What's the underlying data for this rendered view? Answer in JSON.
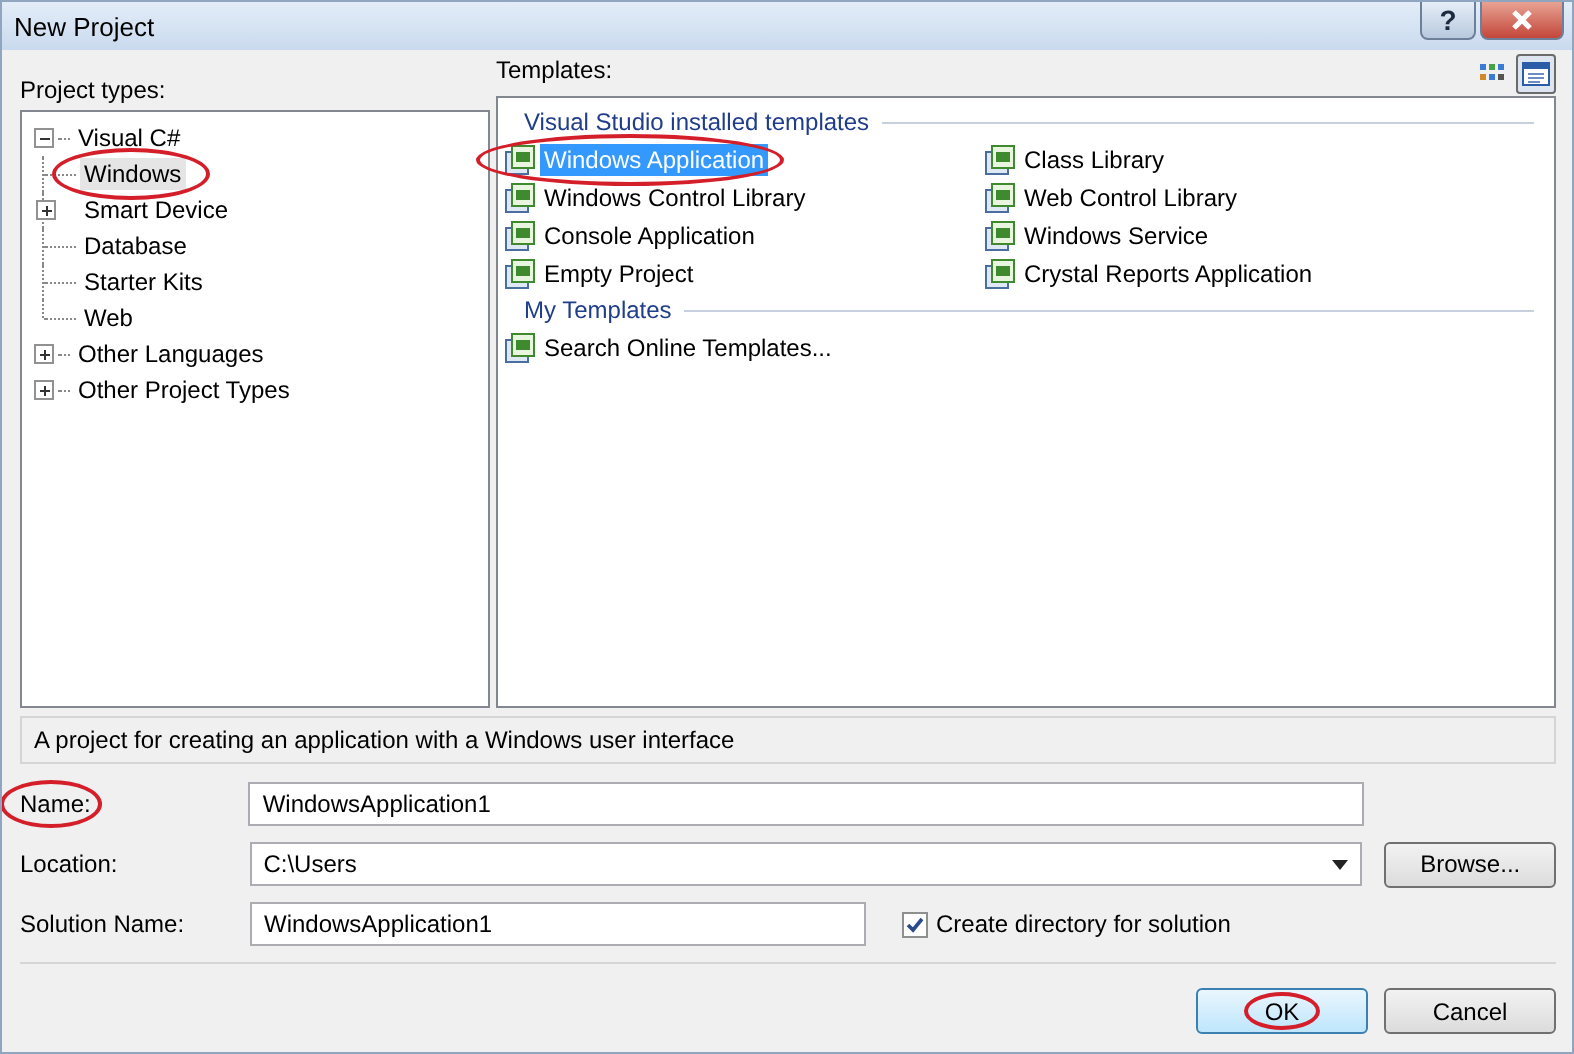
{
  "window": {
    "title": "New Project",
    "help": "?"
  },
  "project_types": {
    "label": "Project types:",
    "tree": [
      {
        "label": "Visual C#",
        "expanded": true,
        "selected": false,
        "children": [
          {
            "label": "Windows",
            "selected": true,
            "circled": true
          },
          {
            "label": "Smart Device",
            "expanded": false,
            "selected": false
          },
          {
            "label": "Database",
            "selected": false
          },
          {
            "label": "Starter Kits",
            "selected": false
          },
          {
            "label": "Web",
            "selected": false
          }
        ]
      },
      {
        "label": "Other Languages",
        "expanded": false,
        "selected": false
      },
      {
        "label": "Other Project Types",
        "expanded": false,
        "selected": false
      }
    ]
  },
  "templates": {
    "label": "Templates:",
    "view_buttons": [
      {
        "selected": false
      },
      {
        "selected": true
      }
    ],
    "groups": [
      {
        "title": "Visual Studio installed templates",
        "items": [
          {
            "label": "Windows Application",
            "selected": true,
            "circled": true
          },
          {
            "label": "Windows Control Library",
            "selected": false
          },
          {
            "label": "Console Application",
            "selected": false
          },
          {
            "label": "Empty Project",
            "selected": false
          },
          {
            "label": "Class Library",
            "selected": false
          },
          {
            "label": "Web Control Library",
            "selected": false
          },
          {
            "label": "Windows Service",
            "selected": false
          },
          {
            "label": "Crystal Reports Application",
            "selected": false
          }
        ]
      },
      {
        "title": "My Templates",
        "items": [
          {
            "label": "Search Online Templates...",
            "selected": false
          }
        ]
      }
    ]
  },
  "description": "A project for creating an application with a Windows user interface",
  "name": {
    "label": "Name:",
    "value": "WindowsApplication1",
    "circled": true
  },
  "location": {
    "label": "Location:",
    "value": "C:\\Users",
    "browse": "Browse..."
  },
  "solution_name": {
    "label": "Solution Name:",
    "value": "WindowsApplication1"
  },
  "create_directory": {
    "label": "Create directory for solution",
    "checked": true
  },
  "buttons": [
    {
      "label": "OK",
      "default": true,
      "circled": true
    },
    {
      "label": "Cancel",
      "default": false
    }
  ]
}
